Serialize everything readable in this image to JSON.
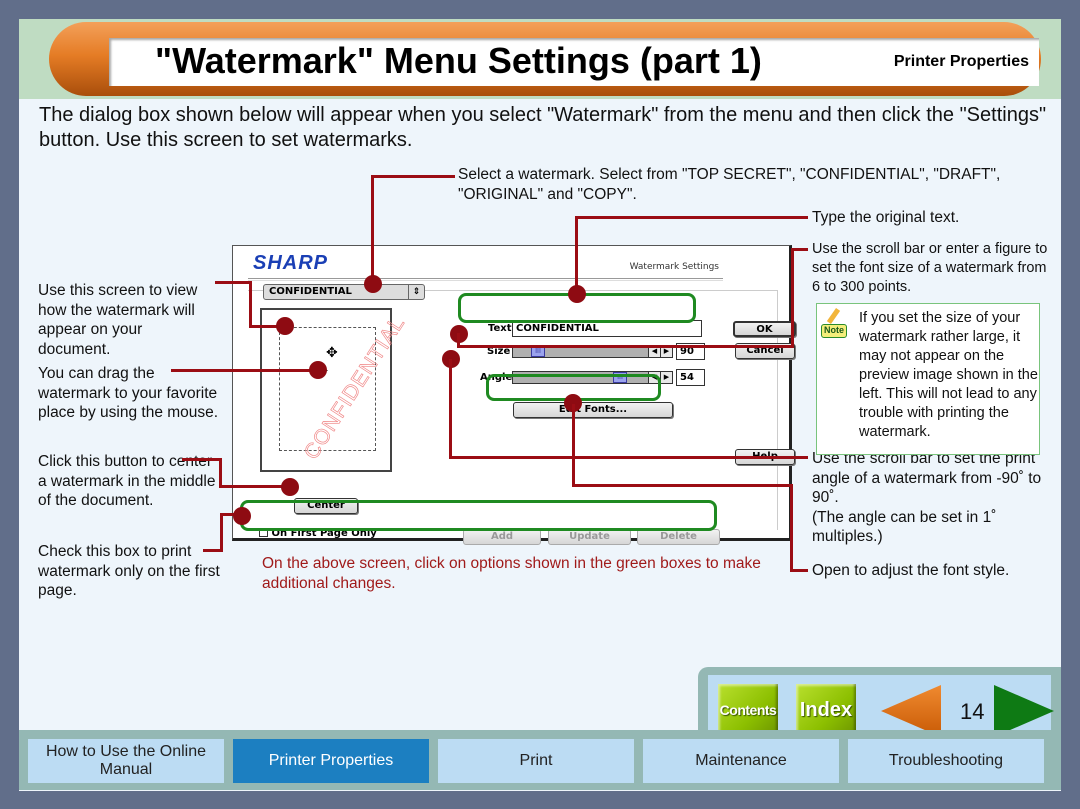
{
  "header": {
    "title": "\"Watermark\" Menu Settings (part 1)",
    "section": "Printer Properties"
  },
  "intro": "The dialog box shown below will appear when you select \"Watermark\" from the menu and then click the \"Settings\" button. Use this screen to set watermarks.",
  "callouts": {
    "select_watermark": "Select a watermark. Select from \"TOP SECRET\", \"CONFIDENTIAL\", \"DRAFT\", \"ORIGINAL\" and \"COPY\".",
    "type_text": "Type the original text.",
    "font_size": "Use the scroll bar or enter a figure to set the font size of a watermark from 6 to 300 points.",
    "preview": "Use this screen to view how the watermark will appear on your document.",
    "drag": "You can drag the watermark to your favorite place by using the mouse.",
    "center": "Click this button to center a watermark in the middle of the document.",
    "first_page": "Check this box to print watermark only on the first page.",
    "angle": "Use the scroll bar to set the print angle of a watermark from -90˚ to 90˚.",
    "angle_note": " (The angle can be set in 1˚ multiples.)",
    "edit_fonts": "Open to adjust the font style."
  },
  "note": {
    "icon_label": "Note",
    "text": "If you set the size of your watermark rather large, it may not appear on the preview image shown in the left. This will not lead to any trouble with printing the watermark."
  },
  "red_note": "On the above screen, click on options shown in the green boxes to make additional changes.",
  "dialog": {
    "brand": "SHARP",
    "title": "Watermark Settings",
    "watermark_select": "CONFIDENTIAL",
    "preview_watermark": "CONFIDENTIAL",
    "text_label": "Text",
    "text_value": "CONFIDENTIAL",
    "size_label": "Size",
    "size_value": "90",
    "angle_label": "Angle",
    "angle_value": "54",
    "edit_fonts": "Edit Fonts...",
    "ok": "OK",
    "cancel": "Cancel",
    "help": "Help",
    "center": "Center",
    "first_page_only": "On First Page Only",
    "add": "Add",
    "update": "Update",
    "delete": "Delete"
  },
  "nav": {
    "contents": "Contents",
    "index": "Index",
    "page_number": "14"
  },
  "tabs": [
    {
      "label": "How to Use the Online Manual",
      "active": false
    },
    {
      "label": "Printer Properties",
      "active": true
    },
    {
      "label": "Print",
      "active": false
    },
    {
      "label": "Maintenance",
      "active": false
    },
    {
      "label": "Troubleshooting",
      "active": false
    }
  ],
  "colors": {
    "accent_orange": "#e57c25",
    "callout_red": "#9b0d14",
    "green_box": "#1f8a21",
    "active_tab": "#1c7fc1"
  }
}
